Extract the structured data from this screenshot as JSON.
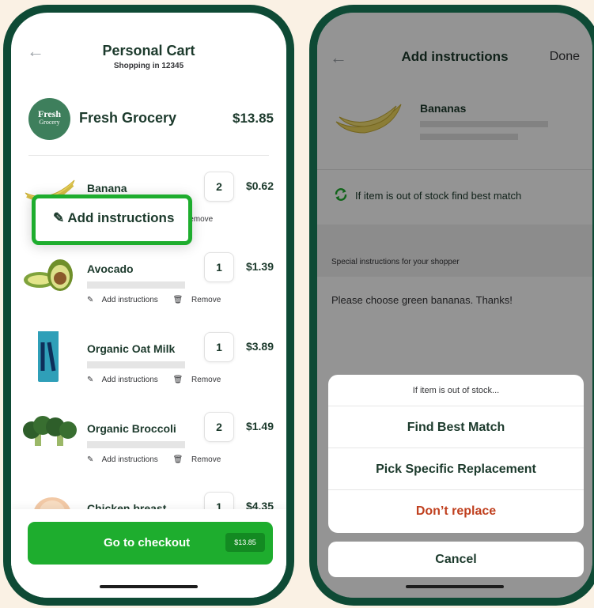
{
  "cart_screen": {
    "back_glyph": "←",
    "title": "Personal Cart",
    "subtitle": "Shopping in 12345",
    "store": {
      "logo_line1": "Fresh",
      "logo_line2": "Grocery",
      "name": "Fresh Grocery",
      "total": "$13.85"
    },
    "items": [
      {
        "name": "Banana",
        "qty": "2",
        "price": "$0.62",
        "add_instructions": "Add instructions",
        "remove": "Remove",
        "image": "banana"
      },
      {
        "name": "Avocado",
        "qty": "1",
        "price": "$1.39",
        "add_instructions": "Add instructions",
        "remove": "Remove",
        "image": "avocado"
      },
      {
        "name": "Organic Oat Milk",
        "qty": "1",
        "price": "$3.89",
        "add_instructions": "Add instructions",
        "remove": "Remove",
        "image": "oat-milk"
      },
      {
        "name": "Organic Broccoli",
        "qty": "2",
        "price": "$1.49",
        "add_instructions": "Add instructions",
        "remove": "Remove",
        "image": "broccoli"
      },
      {
        "name": "Chicken breast",
        "qty": "1",
        "price": "$4.35",
        "image": "chicken"
      }
    ],
    "highlight_label": "Add instructions",
    "checkout": {
      "label": "Go to checkout",
      "amount": "$13.85"
    }
  },
  "instructions_screen": {
    "back_glyph": "←",
    "title": "Add instructions",
    "done_label": "Done",
    "product_name": "Bananas",
    "out_of_stock_text": "If item is out of stock find best match",
    "section_header": "Special instructions for your shopper",
    "note_text": "Please choose green bananas. Thanks!",
    "sheet": {
      "title": "If item is out of stock...",
      "options": [
        "Find Best Match",
        "Pick Specific Replacement",
        "Don’t replace"
      ],
      "cancel": "Cancel"
    }
  },
  "colors": {
    "phone_frame": "#0E4A35",
    "brand_green": "#1EAD2E",
    "dark_text": "#1c3a2c",
    "danger": "#C0401F",
    "background": "#FAF1E4"
  }
}
